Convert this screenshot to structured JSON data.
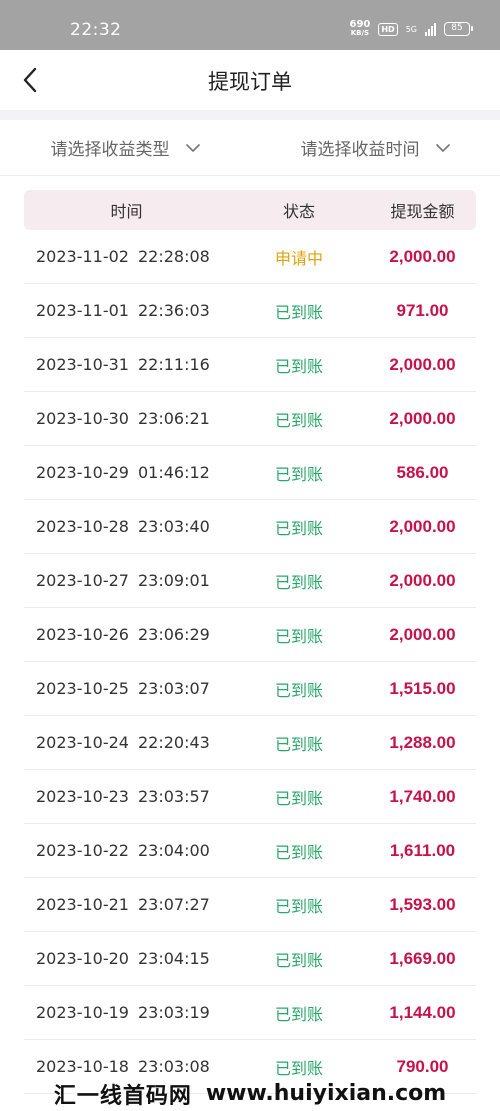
{
  "status_bar": {
    "time": "22:32",
    "net_speed_value": "690",
    "net_speed_unit": "KB/S",
    "hd_label": "HD",
    "network_label": "5G",
    "battery": "85"
  },
  "nav": {
    "title": "提现订单"
  },
  "filters": {
    "type_placeholder": "请选择收益类型",
    "time_placeholder": "请选择收益时间"
  },
  "table": {
    "headers": {
      "time": "时间",
      "status": "状态",
      "amount": "提现金额"
    },
    "rows": [
      {
        "date": "2023-11-02",
        "time": "22:28:08",
        "status": "申请中",
        "status_kind": "pending",
        "amount": "2,000.00"
      },
      {
        "date": "2023-11-01",
        "time": "22:36:03",
        "status": "已到账",
        "status_kind": "done",
        "amount": "971.00"
      },
      {
        "date": "2023-10-31",
        "time": "22:11:16",
        "status": "已到账",
        "status_kind": "done",
        "amount": "2,000.00"
      },
      {
        "date": "2023-10-30",
        "time": "23:06:21",
        "status": "已到账",
        "status_kind": "done",
        "amount": "2,000.00"
      },
      {
        "date": "2023-10-29",
        "time": "01:46:12",
        "status": "已到账",
        "status_kind": "done",
        "amount": "586.00"
      },
      {
        "date": "2023-10-28",
        "time": "23:03:40",
        "status": "已到账",
        "status_kind": "done",
        "amount": "2,000.00"
      },
      {
        "date": "2023-10-27",
        "time": "23:09:01",
        "status": "已到账",
        "status_kind": "done",
        "amount": "2,000.00"
      },
      {
        "date": "2023-10-26",
        "time": "23:06:29",
        "status": "已到账",
        "status_kind": "done",
        "amount": "2,000.00"
      },
      {
        "date": "2023-10-25",
        "time": "23:03:07",
        "status": "已到账",
        "status_kind": "done",
        "amount": "1,515.00"
      },
      {
        "date": "2023-10-24",
        "time": "22:20:43",
        "status": "已到账",
        "status_kind": "done",
        "amount": "1,288.00"
      },
      {
        "date": "2023-10-23",
        "time": "23:03:57",
        "status": "已到账",
        "status_kind": "done",
        "amount": "1,740.00"
      },
      {
        "date": "2023-10-22",
        "time": "23:04:00",
        "status": "已到账",
        "status_kind": "done",
        "amount": "1,611.00"
      },
      {
        "date": "2023-10-21",
        "time": "23:07:27",
        "status": "已到账",
        "status_kind": "done",
        "amount": "1,593.00"
      },
      {
        "date": "2023-10-20",
        "time": "23:04:15",
        "status": "已到账",
        "status_kind": "done",
        "amount": "1,669.00"
      },
      {
        "date": "2023-10-19",
        "time": "23:03:19",
        "status": "已到账",
        "status_kind": "done",
        "amount": "1,144.00"
      },
      {
        "date": "2023-10-18",
        "time": "23:03:08",
        "status": "已到账",
        "status_kind": "done",
        "amount": "790.00"
      }
    ]
  },
  "watermark": {
    "text_cn": "汇一线首码网",
    "text_url": "www.huiyixian.com"
  },
  "colors": {
    "amount": "#c8124a",
    "status_done": "#2aa86a",
    "status_pending": "#e2a20f",
    "header_bg": "#f6ebee",
    "status_bar_bg": "#a3a3a3"
  },
  "icons": {
    "back": "chevron-left-icon",
    "dropdown": "chevron-down-icon"
  }
}
